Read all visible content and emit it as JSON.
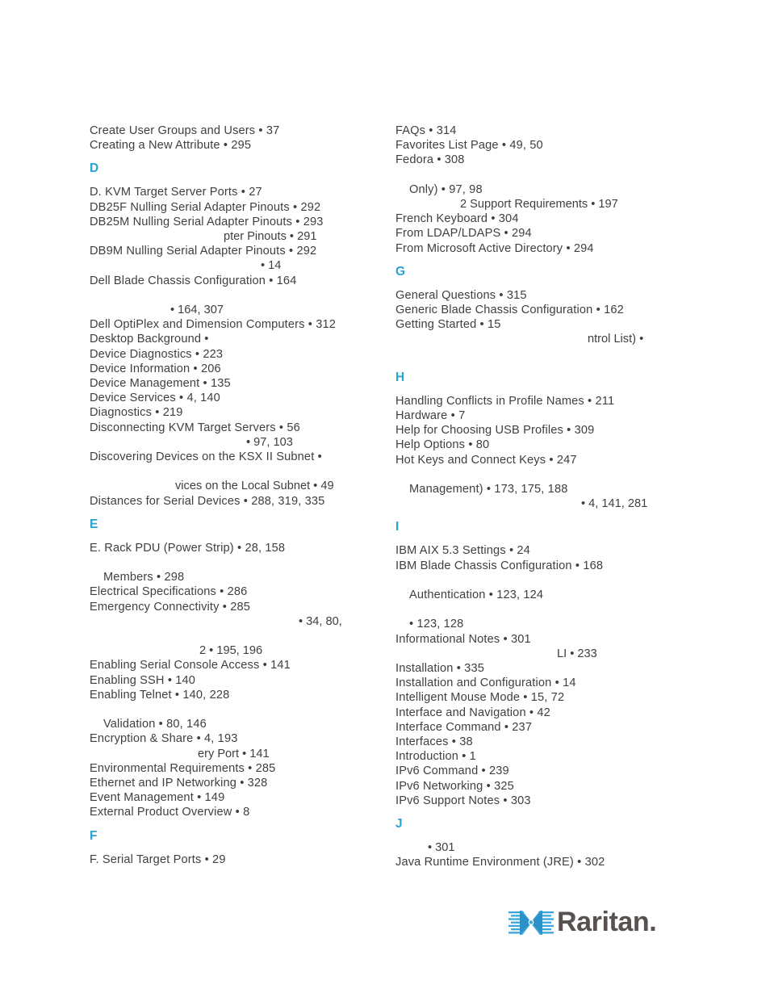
{
  "document": {
    "type": "index",
    "brand": {
      "name": "Raritan.",
      "mark_color": "#3aa7dc",
      "mark_color_dark": "#1f7fb5",
      "word_color": "#58514f"
    },
    "heading_color": "#29a3d4",
    "text_color": "#3f3f3f"
  },
  "columns": [
    {
      "id": "left-column",
      "blocks": [
        {
          "kind": "entries",
          "items": [
            "Create User Groups and Users • 37",
            "Creating a New Attribute • 295"
          ]
        },
        {
          "kind": "letter",
          "label": "D"
        },
        {
          "kind": "entries",
          "items": [
            "D. KVM Target Server Ports • 27",
            "DB25F Nulling Serial Adapter Pinouts • 292",
            "DB25M Nulling Serial Adapter Pinouts • 293"
          ]
        },
        {
          "kind": "fragment",
          "text": "pter Pinouts • 291",
          "offset": 166
        },
        {
          "kind": "entries",
          "items": [
            "DB9M Nulling Serial Adapter Pinouts • 292"
          ]
        },
        {
          "kind": "fragment",
          "text": "• 14",
          "offset": 212
        },
        {
          "kind": "entries",
          "items": [
            "Dell Blade Chassis Configuration • 164"
          ]
        },
        {
          "kind": "blank"
        },
        {
          "kind": "fragment",
          "text": "• 164, 307",
          "offset": 100
        },
        {
          "kind": "entries",
          "items": [
            "Dell OptiPlex and Dimension Computers • 312",
            "Desktop Background •",
            "Device Diagnostics • 223",
            "Device Information • 206",
            "Device Management • 135",
            "Device Services • 4, 140",
            "Diagnostics • 219",
            "Disconnecting KVM Target Servers • 56"
          ]
        },
        {
          "kind": "fragment",
          "text": "• 97, 103",
          "offset": 194
        },
        {
          "kind": "entries",
          "items": [
            "Discovering Devices on the KSX II Subnet •"
          ]
        },
        {
          "kind": "blank"
        },
        {
          "kind": "fragment",
          "text": "vices on the Local Subnet • 49",
          "offset": 106
        },
        {
          "kind": "entries",
          "items": [
            "Distances for Serial Devices • 288, 319, 335"
          ]
        },
        {
          "kind": "letter",
          "label": "E"
        },
        {
          "kind": "entries",
          "items": [
            "E. Rack PDU (Power Strip) • 28, 158"
          ]
        },
        {
          "kind": "blank"
        },
        {
          "kind": "entries",
          "indent": 1,
          "items": [
            "Members • 298"
          ]
        },
        {
          "kind": "entries",
          "items": [
            "Electrical Specifications • 286",
            "Emergency Connectivity • 285"
          ]
        },
        {
          "kind": "fragment",
          "text": "• 34, 80,",
          "offset": 259
        },
        {
          "kind": "blank"
        },
        {
          "kind": "fragment",
          "text": "2 • 195, 196",
          "offset": 136
        },
        {
          "kind": "entries",
          "items": [
            "Enabling Serial Console Access • 141",
            "Enabling SSH • 140",
            "Enabling Telnet • 140, 228"
          ]
        },
        {
          "kind": "blank"
        },
        {
          "kind": "entries",
          "indent": 1,
          "items": [
            "Validation • 80, 146"
          ]
        },
        {
          "kind": "entries",
          "items": [
            "Encryption & Share • 4, 193"
          ]
        },
        {
          "kind": "fragment",
          "text": "ery Port • 141",
          "offset": 134
        },
        {
          "kind": "entries",
          "items": [
            "Environmental Requirements • 285",
            "Ethernet and IP Networking • 328",
            "Event Management • 149",
            "External Product Overview • 8"
          ]
        },
        {
          "kind": "letter",
          "label": "F"
        },
        {
          "kind": "entries",
          "items": [
            "F. Serial Target Ports • 29"
          ]
        }
      ]
    },
    {
      "id": "right-column",
      "blocks": [
        {
          "kind": "entries",
          "items": [
            "FAQs • 314",
            "Favorites List Page • 49, 50",
            "Fedora • 308"
          ]
        },
        {
          "kind": "blank"
        },
        {
          "kind": "entries",
          "indent": 1,
          "items": [
            "Only) • 97, 98"
          ]
        },
        {
          "kind": "fragment",
          "text": "2 Support Requirements • 197",
          "offset": 80
        },
        {
          "kind": "entries",
          "items": [
            "French Keyboard • 304",
            "From LDAP/LDAPS • 294",
            "From Microsoft Active Directory • 294"
          ]
        },
        {
          "kind": "letter",
          "label": "G"
        },
        {
          "kind": "entries",
          "items": [
            "General Questions • 315",
            "Generic Blade Chassis Configuration • 162",
            "Getting Started • 15"
          ]
        },
        {
          "kind": "fragment",
          "text": "ntrol List) •",
          "offset": 238
        },
        {
          "kind": "blank"
        },
        {
          "kind": "letter",
          "label": "H"
        },
        {
          "kind": "entries",
          "items": [
            "Handling Conflicts in Profile Names • 211",
            "Hardware • 7",
            "Help for Choosing USB Profiles • 309",
            "Help Options • 80",
            "Hot Keys and Connect Keys • 247"
          ]
        },
        {
          "kind": "blank"
        },
        {
          "kind": "entries",
          "indent": 1,
          "items": [
            "Management) • 173, 175, 188"
          ]
        },
        {
          "kind": "fragment",
          "text": "• 4, 141, 281",
          "offset": 230
        },
        {
          "kind": "letter",
          "label": "I"
        },
        {
          "kind": "entries",
          "items": [
            "IBM AIX 5.3 Settings • 24",
            "IBM Blade Chassis Configuration • 168"
          ]
        },
        {
          "kind": "blank"
        },
        {
          "kind": "entries",
          "indent": 1,
          "items": [
            "Authentication • 123, 124"
          ]
        },
        {
          "kind": "blank"
        },
        {
          "kind": "entries",
          "indent": 1,
          "items": [
            "• 123, 128"
          ]
        },
        {
          "kind": "entries",
          "items": [
            "Informational Notes • 301"
          ]
        },
        {
          "kind": "fragment",
          "text": "LI • 233",
          "offset": 200
        },
        {
          "kind": "entries",
          "items": [
            "Installation • 335",
            "Installation and Configuration • 14",
            "Intelligent Mouse Mode • 15, 72",
            "Interface and Navigation • 42",
            "Interface Command • 237",
            "Interfaces • 38",
            "Introduction • 1",
            "IPv6 Command • 239",
            "IPv6 Networking • 325",
            "IPv6 Support Notes • 303"
          ]
        },
        {
          "kind": "letter",
          "label": "J"
        },
        {
          "kind": "fragment",
          "text": "• 301",
          "offset": 40
        },
        {
          "kind": "entries",
          "items": [
            "Java Runtime Environment (JRE) • 302"
          ]
        }
      ]
    }
  ]
}
